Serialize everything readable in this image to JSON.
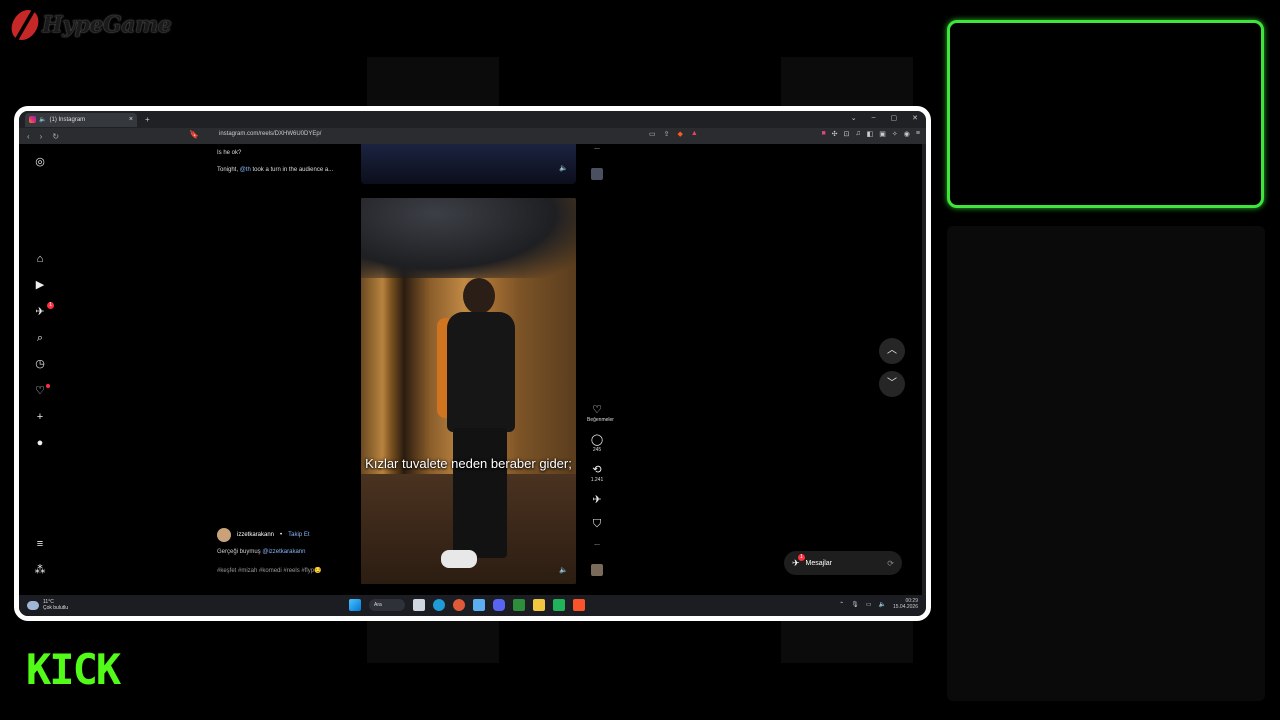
{
  "overlay": {
    "brand_logo_text": "HypeGame",
    "kick_logo_text": "KICK"
  },
  "browser": {
    "tab_title": "(1) Instagram",
    "tab_close": "×",
    "new_tab": "+",
    "url": "instagram.com/reels/DXHW6U0DYEp/"
  },
  "feed": {
    "prev_caption_1": "Is he ok?",
    "prev_caption_2_pre": "Tonight, ",
    "prev_caption_2_mention": "@th",
    "prev_caption_2_post": " took a turn in the audience a...",
    "subtitle": "Kızlar tuvalete neden beraber gider;",
    "username": "izzetkarakann",
    "separator": "•",
    "follow_label": "Takip Et",
    "caption_pre": "Gerçeği buymuş ",
    "caption_mention": "@izzetkarakann",
    "hashtags": "#keşfet #mizah #komedi #reels #flyp😏",
    "likes_label": "Beğenmeler",
    "comments_count": "245",
    "reposts_count": "1.241",
    "more_label": "...",
    "notif_badge": "1"
  },
  "messages": {
    "label": "Mesajlar",
    "badge": "1"
  },
  "taskbar": {
    "temp": "11°C",
    "weather": "Çok bulutlu",
    "search": "Ara",
    "time": "00:29",
    "date": "15.04.2026"
  },
  "colors": {
    "kick_green": "#53fc18",
    "camera_border": "#3ee53a",
    "instagram_link": "#8ab4f8",
    "notification_red": "#ff3040"
  }
}
